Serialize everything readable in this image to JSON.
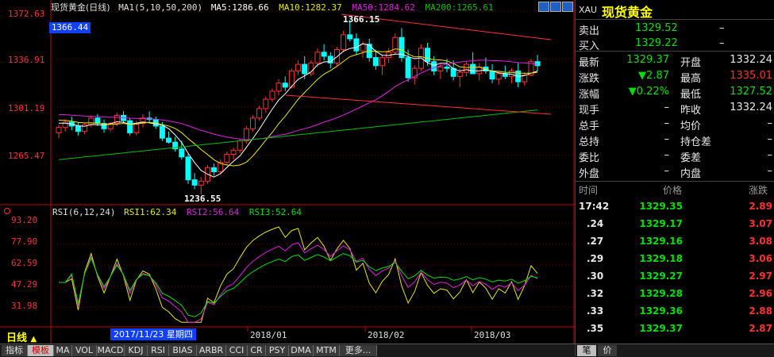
{
  "header": {
    "title": "现货黄金(日线)",
    "ma_label": "MA1(5,10,50,200)",
    "ma5": "MA5:1286.66",
    "ma10": "MA10:1282.37",
    "ma50": "MA50:1284.62",
    "ma200": "MA200:1265.61",
    "current_price_tag": "1366.44"
  },
  "colors": {
    "up": "#ff3030",
    "down": "#00ffff",
    "ma5": "#ffffff",
    "ma10": "#e8e800",
    "ma50": "#e020e0",
    "ma200": "#00c000",
    "trend": "#ff3030"
  },
  "price_axis": [
    "1372.63",
    "1336.91",
    "1301.19",
    "1265.47"
  ],
  "annotations": {
    "high": "1366.15",
    "low": "1236.55"
  },
  "rsi_header": {
    "label": "RSI(6,12,24)",
    "rsi1": "RSI1:62.34",
    "rsi2": "RSI2:56.64",
    "rsi3": "RSI3:52.64"
  },
  "rsi_axis": [
    "93.20",
    "77.90",
    "62.59",
    "47.29",
    "31.98"
  ],
  "period_button": "日线",
  "date_axis": {
    "cursor_date": "2017/11/23 星期四",
    "labels": [
      "2018/01",
      "2018/02",
      "2018/03"
    ]
  },
  "tabs": [
    "指标",
    "模板",
    "MA",
    "VOL",
    "MACD",
    "KDJ",
    "RSI",
    "BIAS",
    "ARBR",
    "CCI",
    "CR",
    "PSY",
    "DMA",
    "MTM",
    "更多..."
  ],
  "chart_data": {
    "type": "candlestick",
    "note_series": "daily candles for XAU, values approximate",
    "ylim": [
      1232,
      1375
    ],
    "candles": [
      [
        1282,
        1288,
        1278,
        1286
      ],
      [
        1286,
        1292,
        1283,
        1290
      ],
      [
        1290,
        1294,
        1284,
        1287
      ],
      [
        1287,
        1290,
        1280,
        1283
      ],
      [
        1283,
        1289,
        1281,
        1288
      ],
      [
        1288,
        1295,
        1286,
        1293
      ],
      [
        1293,
        1296,
        1287,
        1289
      ],
      [
        1289,
        1292,
        1282,
        1285
      ],
      [
        1285,
        1290,
        1283,
        1289
      ],
      [
        1289,
        1297,
        1287,
        1295
      ],
      [
        1295,
        1298,
        1289,
        1291
      ],
      [
        1291,
        1293,
        1280,
        1282
      ],
      [
        1282,
        1291,
        1280,
        1289
      ],
      [
        1289,
        1296,
        1286,
        1293
      ],
      [
        1293,
        1298,
        1290,
        1292
      ],
      [
        1292,
        1294,
        1285,
        1287
      ],
      [
        1287,
        1290,
        1276,
        1278
      ],
      [
        1278,
        1283,
        1274,
        1275
      ],
      [
        1275,
        1279,
        1268,
        1270
      ],
      [
        1270,
        1276,
        1262,
        1264
      ],
      [
        1264,
        1266,
        1244,
        1247
      ],
      [
        1247,
        1252,
        1240,
        1243
      ],
      [
        1243,
        1249,
        1236,
        1246
      ],
      [
        1246,
        1258,
        1244,
        1256
      ],
      [
        1256,
        1259,
        1250,
        1253
      ],
      [
        1253,
        1262,
        1251,
        1260
      ],
      [
        1260,
        1268,
        1258,
        1266
      ],
      [
        1266,
        1271,
        1262,
        1269
      ],
      [
        1269,
        1278,
        1267,
        1276
      ],
      [
        1276,
        1287,
        1274,
        1285
      ],
      [
        1285,
        1295,
        1283,
        1293
      ],
      [
        1293,
        1302,
        1291,
        1300
      ],
      [
        1300,
        1309,
        1297,
        1307
      ],
      [
        1307,
        1315,
        1305,
        1313
      ],
      [
        1313,
        1322,
        1310,
        1319
      ],
      [
        1319,
        1324,
        1313,
        1316
      ],
      [
        1316,
        1330,
        1315,
        1328
      ],
      [
        1328,
        1336,
        1325,
        1333
      ],
      [
        1333,
        1339,
        1322,
        1326
      ],
      [
        1326,
        1336,
        1324,
        1334
      ],
      [
        1334,
        1345,
        1331,
        1342
      ],
      [
        1342,
        1348,
        1336,
        1339
      ],
      [
        1339,
        1342,
        1330,
        1334
      ],
      [
        1334,
        1346,
        1332,
        1344
      ],
      [
        1344,
        1358,
        1342,
        1355
      ],
      [
        1355,
        1366,
        1350,
        1352
      ],
      [
        1352,
        1356,
        1340,
        1343
      ],
      [
        1343,
        1350,
        1338,
        1348
      ],
      [
        1348,
        1352,
        1335,
        1338
      ],
      [
        1338,
        1344,
        1329,
        1332
      ],
      [
        1332,
        1340,
        1325,
        1338
      ],
      [
        1338,
        1345,
        1334,
        1342
      ],
      [
        1342,
        1356,
        1340,
        1353
      ],
      [
        1353,
        1360,
        1335,
        1338
      ],
      [
        1338,
        1344,
        1320,
        1323
      ],
      [
        1323,
        1332,
        1318,
        1330
      ],
      [
        1330,
        1348,
        1328,
        1345
      ],
      [
        1345,
        1349,
        1332,
        1335
      ],
      [
        1335,
        1339,
        1325,
        1328
      ],
      [
        1328,
        1334,
        1322,
        1331
      ],
      [
        1331,
        1337,
        1327,
        1330
      ],
      [
        1330,
        1336,
        1321,
        1324
      ],
      [
        1324,
        1330,
        1316,
        1327
      ],
      [
        1327,
        1335,
        1324,
        1333
      ],
      [
        1333,
        1342,
        1330,
        1326
      ],
      [
        1326,
        1334,
        1321,
        1331
      ],
      [
        1331,
        1338,
        1326,
        1328
      ],
      [
        1328,
        1333,
        1319,
        1322
      ],
      [
        1322,
        1328,
        1318,
        1326
      ],
      [
        1326,
        1332,
        1322,
        1324
      ],
      [
        1324,
        1330,
        1319,
        1328
      ],
      [
        1328,
        1334,
        1316,
        1320
      ],
      [
        1320,
        1327,
        1317,
        1325
      ],
      [
        1325,
        1337,
        1324,
        1335
      ],
      [
        1335,
        1340,
        1328,
        1332
      ]
    ]
  },
  "panel": {
    "symbol": "XAU",
    "name": "现货黄金",
    "rows": [
      [
        {
          "t": "卖出",
          "c": "w"
        },
        {
          "t": "1329.52",
          "c": "g"
        },
        {
          "t": "–",
          "c": "w"
        }
      ],
      [
        {
          "t": "买入",
          "c": "w"
        },
        {
          "t": "1329.22",
          "c": "g"
        },
        {
          "t": "–",
          "c": "w"
        }
      ]
    ],
    "stats": [
      [
        "最新",
        "1329.37",
        "g",
        "开盘",
        "1332.24",
        "w"
      ],
      [
        "涨跌",
        "▼2.87",
        "g",
        "最高",
        "1335.01",
        "r"
      ],
      [
        "涨幅",
        "▼0.22%",
        "g",
        "最低",
        "1327.52",
        "g"
      ],
      [
        "现手",
        "–",
        "w",
        "昨收",
        "1332.24",
        "w"
      ],
      [
        "总手",
        "–",
        "w",
        "均价",
        "–",
        "w"
      ],
      [
        "总持",
        "–",
        "w",
        "持仓差",
        "–",
        "w"
      ],
      [
        "委比",
        "–",
        "w",
        "委差",
        "–",
        "w"
      ],
      [
        "外盘",
        "–",
        "w",
        "内盘",
        "–",
        "w"
      ]
    ],
    "tick_header": [
      "时间",
      "价格",
      "涨跌"
    ],
    "ticks": [
      [
        "17:42",
        "1329.35",
        "2.89"
      ],
      [
        ".24",
        "1329.17",
        "3.07"
      ],
      [
        ".27",
        "1329.16",
        "3.08"
      ],
      [
        ".29",
        "1329.18",
        "3.06"
      ],
      [
        ".30",
        "1329.27",
        "2.97"
      ],
      [
        ".32",
        "1329.28",
        "2.96"
      ],
      [
        ".33",
        "1329.36",
        "2.88"
      ],
      [
        ".35",
        "1329.37",
        "2.87"
      ]
    ],
    "bottom_tabs": [
      "笔",
      "价"
    ]
  }
}
